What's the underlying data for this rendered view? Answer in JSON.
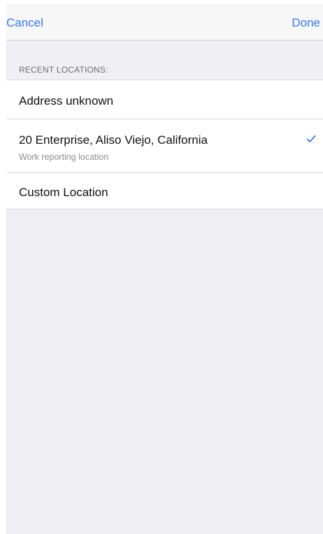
{
  "navbar": {
    "cancel_label": "Cancel",
    "done_label": "Done"
  },
  "section": {
    "header": "RECENT LOCATIONS:"
  },
  "locations": [
    {
      "title": "Address unknown",
      "subtitle": "",
      "selected": false
    },
    {
      "title": "20 Enterprise, Aliso Viejo, California",
      "subtitle": "Work reporting location",
      "selected": true
    },
    {
      "title": "Custom Location",
      "subtitle": "",
      "selected": false
    }
  ],
  "colors": {
    "accent": "#3478f6",
    "background": "#efeff4",
    "navbar_background": "#f7f7f7",
    "separator": "#d9d9dd",
    "secondary_text": "#8e8e93"
  },
  "icons": {
    "selected": "checkmark-icon"
  }
}
